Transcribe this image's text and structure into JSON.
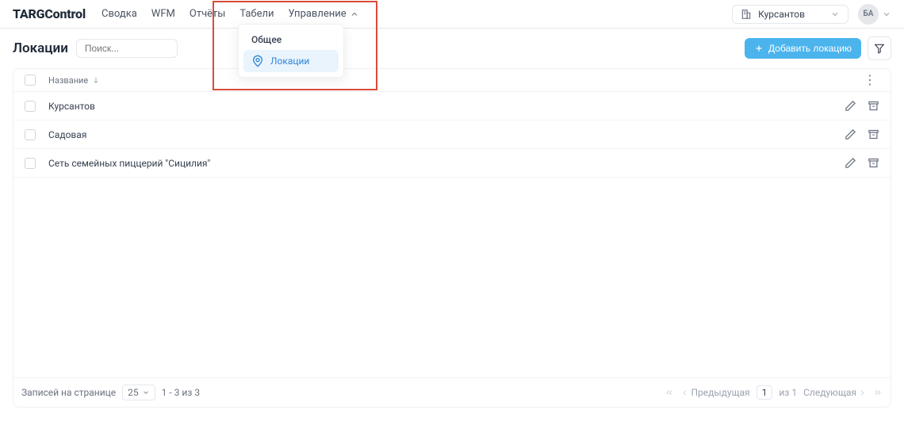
{
  "logo": "TARGControl",
  "nav": {
    "summary": "Сводка",
    "wfm": "WFM",
    "reports": "Отчёты",
    "tables": "Табели",
    "manage": "Управление"
  },
  "org": {
    "name": "Курсантов"
  },
  "avatar": "БА",
  "dropdown": {
    "header": "Общее",
    "locations": "Локации"
  },
  "page": {
    "title": "Локации",
    "search_placeholder": "Поиск...",
    "add_btn": "Добавить локацию"
  },
  "table": {
    "col_name": "Название",
    "rows": [
      {
        "name": "Курсантов"
      },
      {
        "name": "Садовая"
      },
      {
        "name": "Сеть семейных пиццерий \"Сицилия\""
      }
    ]
  },
  "footer": {
    "per_page_label": "Записей на странице",
    "per_page_value": "25",
    "range": "1 - 3 из 3",
    "prev": "Предыдущая",
    "page": "1",
    "of": "из 1",
    "next": "Следующая"
  }
}
